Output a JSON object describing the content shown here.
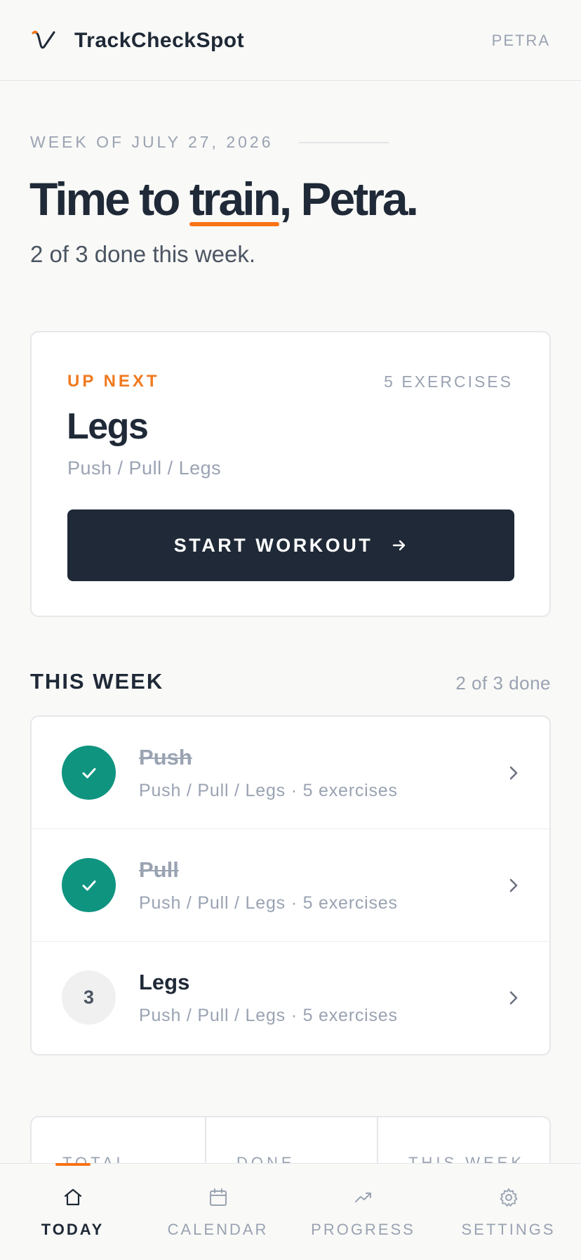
{
  "app": {
    "name": "TrackCheckSpot",
    "user": "PETRA"
  },
  "hero": {
    "week_label": "WEEK OF JULY 27, 2026",
    "greeting_before": "Time to ",
    "greeting_highlight": "train",
    "greeting_after": ", Petra.",
    "progress_text": "2 of 3 done this week."
  },
  "up_next": {
    "label": "UP NEXT",
    "exercise_count": "5 EXERCISES",
    "workout_name": "Legs",
    "program": "Push / Pull / Legs",
    "start_button": "START WORKOUT",
    "progress": {
      "done": 2,
      "total": 3
    }
  },
  "this_week": {
    "title": "THIS WEEK",
    "count": "2 of 3 done",
    "workouts": [
      {
        "name": "Push",
        "detail": "Push / Pull / Legs · 5 exercises",
        "status": "done"
      },
      {
        "name": "Pull",
        "detail": "Push / Pull / Legs · 5 exercises",
        "status": "done"
      },
      {
        "name": "Legs",
        "detail": "Push / Pull / Legs · 5 exercises",
        "status": "pending",
        "number": "3"
      }
    ]
  },
  "stats": {
    "labels": [
      "TOTAL",
      "DONE",
      "THIS WEEK"
    ]
  },
  "tabs": [
    {
      "label": "TODAY",
      "icon": "home-icon",
      "active": true
    },
    {
      "label": "CALENDAR",
      "icon": "calendar-icon",
      "active": false
    },
    {
      "label": "PROGRESS",
      "icon": "trending-up-icon",
      "active": false
    },
    {
      "label": "SETTINGS",
      "icon": "gear-icon",
      "active": false
    }
  ],
  "colors": {
    "accent": "#f97316",
    "done": "#0f9480",
    "primary": "#1f2937",
    "muted": "#9aa3b2",
    "background": "#f9f9f7"
  }
}
